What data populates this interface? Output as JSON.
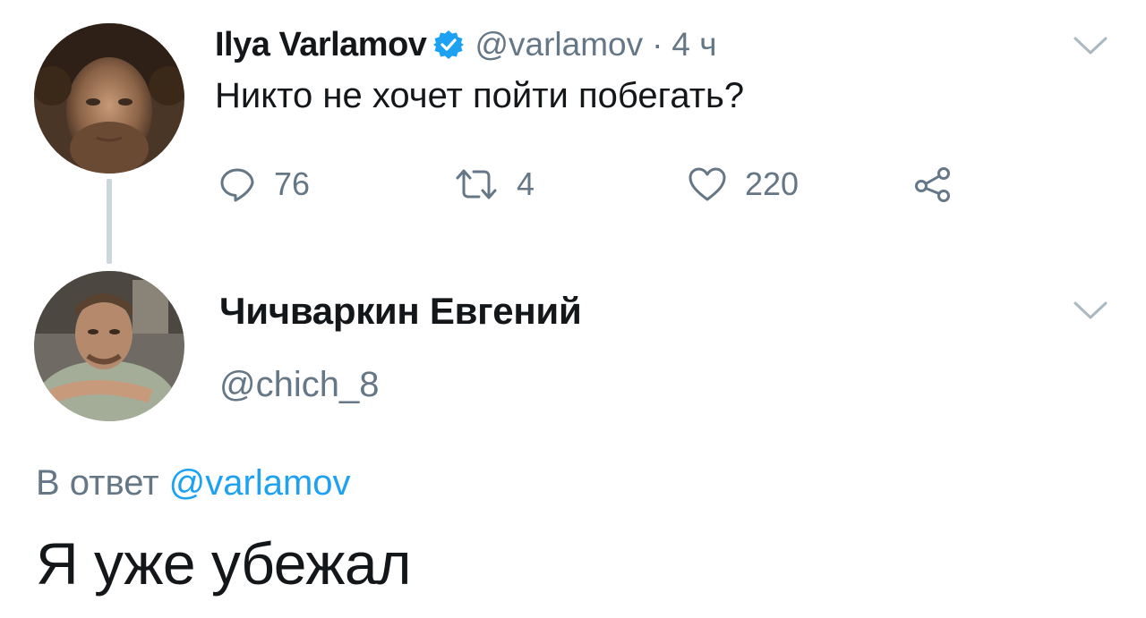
{
  "tweet1": {
    "author_name": "Ilya Varlamov",
    "handle": "@varlamov",
    "separator": "·",
    "time": "4 ч",
    "text": "Никто не хочет пойти побегать?",
    "actions": {
      "replies": "76",
      "retweets": "4",
      "likes": "220"
    }
  },
  "tweet2": {
    "author_name": "Чичваркин Евгений",
    "handle": "@chich_8",
    "reply_prefix": "В ответ",
    "reply_to": "@varlamov",
    "text": "Я уже убежал"
  },
  "colors": {
    "accent": "#1da1f2",
    "muted": "#657786",
    "text": "#14171a",
    "thread_line": "#ccd6dd"
  },
  "icons": [
    "verified-badge-icon",
    "reply-icon",
    "retweet-icon",
    "like-icon",
    "share-icon",
    "chevron-down-icon"
  ]
}
